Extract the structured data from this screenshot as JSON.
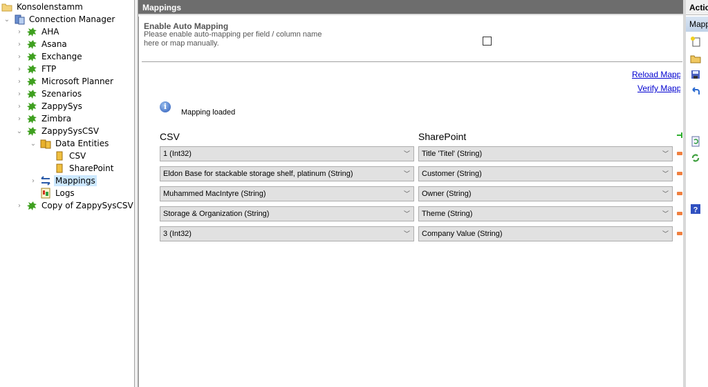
{
  "tree": {
    "root": "Konsolenstamm",
    "connection_manager": "Connection Manager",
    "items": [
      {
        "label": "AHA"
      },
      {
        "label": "Asana"
      },
      {
        "label": "Exchange"
      },
      {
        "label": "FTP"
      },
      {
        "label": "Microsoft Planner"
      },
      {
        "label": "Szenarios"
      },
      {
        "label": "ZappySys"
      },
      {
        "label": "Zimbra"
      },
      {
        "label": "ZappySysCSV"
      }
    ],
    "data_entities": "Data Entities",
    "entities": [
      {
        "label": "CSV"
      },
      {
        "label": "SharePoint"
      }
    ],
    "mappings": "Mappings",
    "logs": "Logs",
    "copy": "Copy of ZappySysCSV"
  },
  "main": {
    "title": "Mappings",
    "auto_title": "Enable Auto Mapping",
    "auto_desc": "Please enable auto-mapping per field / column name here or map manually.",
    "auto_checked": false,
    "reload_link": "Reload Mapping",
    "verify_link": "Verify Mapping",
    "status": "Mapping loaded",
    "csv_header": "CSV",
    "sp_header": "SharePoint",
    "rows": [
      {
        "csv": "1 (Int32)",
        "sp": "Title 'Titel' (String)"
      },
      {
        "csv": "Eldon Base for stackable storage shelf, platinum (String)",
        "sp": "Customer (String)"
      },
      {
        "csv": "Muhammed MacIntyre (String)",
        "sp": "Owner (String)"
      },
      {
        "csv": "Storage & Organization (String)",
        "sp": "Theme (String)"
      },
      {
        "csv": "3 (Int32)",
        "sp": "Company Value (String)"
      }
    ]
  },
  "actions": {
    "title": "Actions",
    "subtitle": "Mappings"
  }
}
